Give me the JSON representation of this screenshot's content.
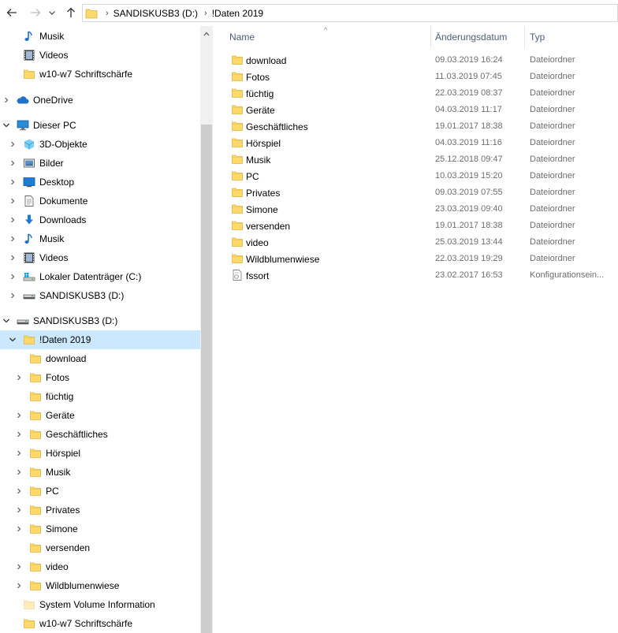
{
  "address": {
    "crumbs": [
      "SANDISKUSB3 (D:)",
      "!Daten 2019"
    ]
  },
  "columns": {
    "name": "Name",
    "date": "Änderungsdatum",
    "type": "Typ"
  },
  "sidebar": {
    "items": [
      {
        "label": "Musik",
        "icon": "music-icon"
      },
      {
        "label": "Videos",
        "icon": "video-icon"
      },
      {
        "label": "w10-w7 Schriftschärfe",
        "icon": "folder-icon"
      },
      {
        "label": "OneDrive",
        "icon": "cloud-icon"
      },
      {
        "label": "Dieser PC",
        "icon": "computer-icon"
      },
      {
        "label": "3D-Objekte",
        "icon": "cube-icon"
      },
      {
        "label": "Bilder",
        "icon": "pictures-icon"
      },
      {
        "label": "Desktop",
        "icon": "desktop-icon"
      },
      {
        "label": "Dokumente",
        "icon": "document-icon"
      },
      {
        "label": "Downloads",
        "icon": "download-arrow-icon"
      },
      {
        "label": "Musik",
        "icon": "music-icon"
      },
      {
        "label": "Videos",
        "icon": "video-icon"
      },
      {
        "label": "Lokaler Datenträger (C:)",
        "icon": "drive-icon"
      },
      {
        "label": "SANDISKUSB3 (D:)",
        "icon": "usb-drive-icon"
      },
      {
        "label": "SANDISKUSB3 (D:)",
        "icon": "usb-drive-icon"
      },
      {
        "label": "!Daten 2019",
        "icon": "folder-icon"
      },
      {
        "label": "download",
        "icon": "folder-icon"
      },
      {
        "label": "Fotos",
        "icon": "folder-icon"
      },
      {
        "label": "füchtig",
        "icon": "folder-icon"
      },
      {
        "label": "Geräte",
        "icon": "folder-icon"
      },
      {
        "label": "Geschäftliches",
        "icon": "folder-icon"
      },
      {
        "label": "Hörspiel",
        "icon": "folder-icon"
      },
      {
        "label": "Musik",
        "icon": "folder-icon"
      },
      {
        "label": "PC",
        "icon": "folder-icon"
      },
      {
        "label": "Privates",
        "icon": "folder-icon"
      },
      {
        "label": "Simone",
        "icon": "folder-icon"
      },
      {
        "label": "versenden",
        "icon": "folder-icon"
      },
      {
        "label": "video",
        "icon": "folder-icon"
      },
      {
        "label": "Wildblumenwiese",
        "icon": "folder-icon"
      },
      {
        "label": "System Volume Information",
        "icon": "folder-icon"
      },
      {
        "label": "w10-w7 Schriftschärfe",
        "icon": "folder-icon"
      }
    ]
  },
  "files": [
    {
      "name": "download",
      "date": "09.03.2019 16:24",
      "type": "Dateiordner",
      "icon": "folder-icon"
    },
    {
      "name": "Fotos",
      "date": "11.03.2019 07:45",
      "type": "Dateiordner",
      "icon": "folder-icon"
    },
    {
      "name": "füchtig",
      "date": "22.03.2019 08:37",
      "type": "Dateiordner",
      "icon": "folder-icon"
    },
    {
      "name": "Geräte",
      "date": "04.03.2019 11:17",
      "type": "Dateiordner",
      "icon": "folder-icon"
    },
    {
      "name": "Geschäftliches",
      "date": "19.01.2017 18:38",
      "type": "Dateiordner",
      "icon": "folder-icon"
    },
    {
      "name": "Hörspiel",
      "date": "04.03.2019 11:16",
      "type": "Dateiordner",
      "icon": "folder-icon"
    },
    {
      "name": "Musik",
      "date": "25.12.2018 09:47",
      "type": "Dateiordner",
      "icon": "folder-icon"
    },
    {
      "name": "PC",
      "date": "10.03.2019 15:20",
      "type": "Dateiordner",
      "icon": "folder-icon"
    },
    {
      "name": "Privates",
      "date": "09.03.2019 07:55",
      "type": "Dateiordner",
      "icon": "folder-icon"
    },
    {
      "name": "Simone",
      "date": "23.03.2019 09:40",
      "type": "Dateiordner",
      "icon": "folder-icon"
    },
    {
      "name": "versenden",
      "date": "19.01.2017 18:38",
      "type": "Dateiordner",
      "icon": "folder-icon"
    },
    {
      "name": "video",
      "date": "25.03.2019 13:44",
      "type": "Dateiordner",
      "icon": "folder-icon"
    },
    {
      "name": "Wildblumenwiese",
      "date": "22.03.2019 19:29",
      "type": "Dateiordner",
      "icon": "folder-icon"
    },
    {
      "name": "fssort",
      "date": "23.02.2017 16:53",
      "type": "Konfigurationsein...",
      "icon": "config-file-icon"
    }
  ],
  "colors": {
    "selection": "#cce8ff",
    "folder": "#ffd96b",
    "header_text": "#4c607a"
  }
}
